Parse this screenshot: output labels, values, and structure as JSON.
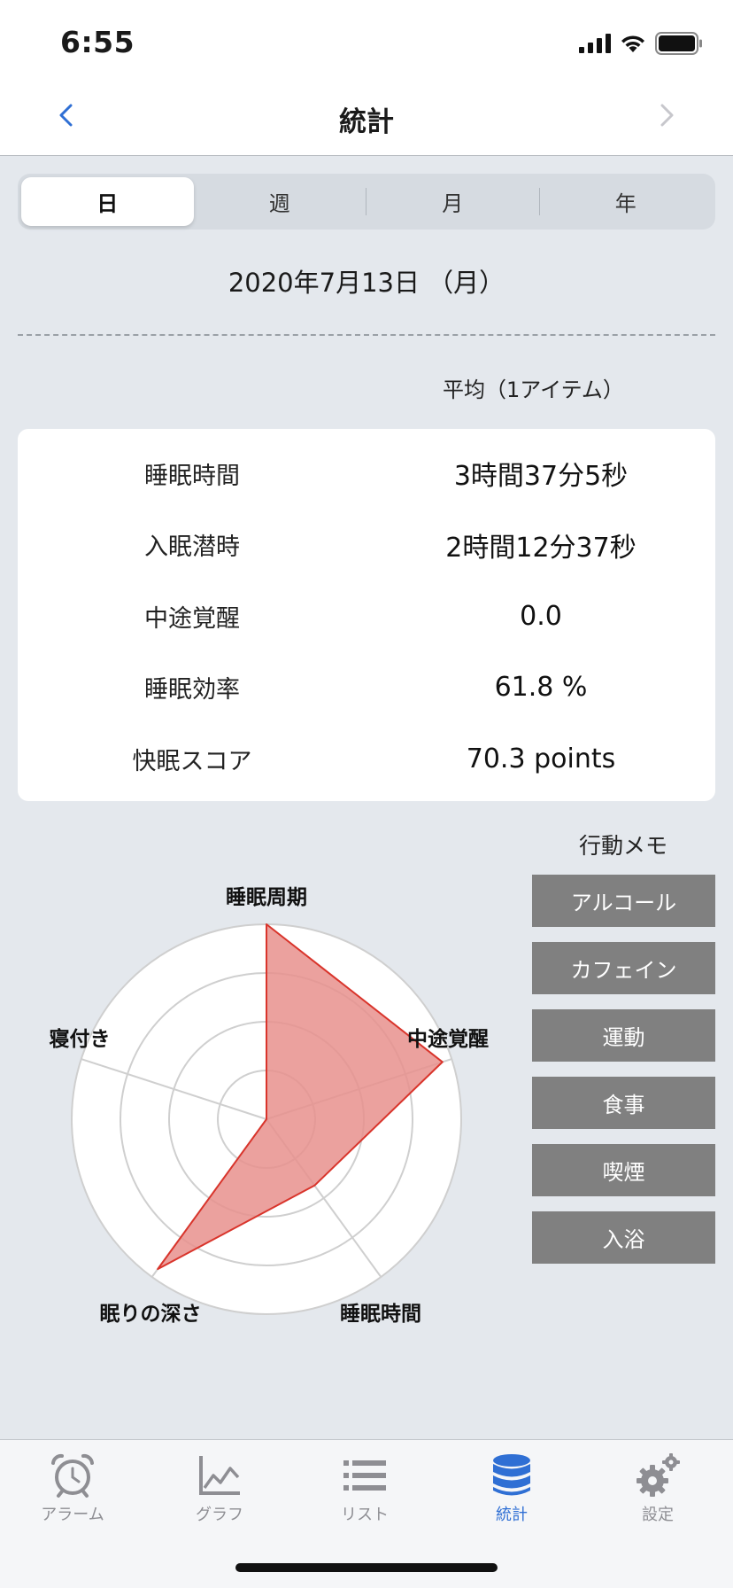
{
  "status": {
    "time": "6:55"
  },
  "nav": {
    "title": "統計"
  },
  "segments": [
    "日",
    "週",
    "月",
    "年"
  ],
  "date": "2020年7月13日 （月）",
  "average_label": "平均（1アイテム）",
  "stats": [
    {
      "label": "睡眠時間",
      "value": "3時間37分5秒"
    },
    {
      "label": "入眠潜時",
      "value": "2時間12分37秒"
    },
    {
      "label": "中途覚醒",
      "value": "0.0"
    },
    {
      "label": "睡眠効率",
      "value": "61.8 %"
    },
    {
      "label": "快眠スコア",
      "value": "70.3 points"
    }
  ],
  "memo": {
    "title": "行動メモ",
    "buttons": [
      "アルコール",
      "カフェイン",
      "運動",
      "食事",
      "喫煙",
      "入浴"
    ]
  },
  "chart_data": {
    "type": "radar",
    "axes": [
      "睡眠周期",
      "中途覚醒",
      "睡眠時間",
      "眠りの深さ",
      "寝付き"
    ],
    "values": [
      1.0,
      0.95,
      0.42,
      0.95,
      0.0
    ],
    "rmax": 1.0,
    "rings": 4,
    "fill_color": "#e8918d",
    "stroke_color": "#d9342b"
  },
  "tabs": [
    {
      "label": "アラーム",
      "icon": "alarm-clock-icon"
    },
    {
      "label": "グラフ",
      "icon": "line-chart-icon"
    },
    {
      "label": "リスト",
      "icon": "list-icon"
    },
    {
      "label": "統計",
      "icon": "database-icon",
      "active": true
    },
    {
      "label": "設定",
      "icon": "gears-icon"
    }
  ]
}
